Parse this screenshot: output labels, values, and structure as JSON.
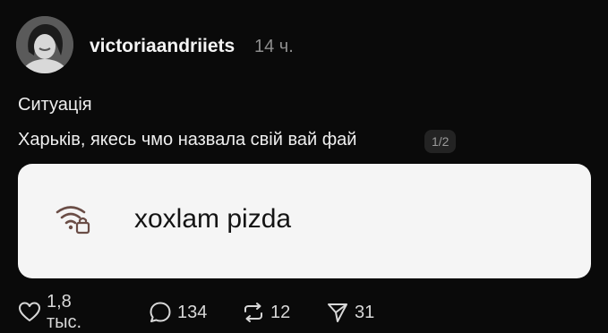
{
  "post": {
    "author": "victoriaandriiets",
    "time": "14 ч.",
    "line1": "Ситуація",
    "line2": "Харьків, якесь чмо назвала свій вай фай",
    "pager": "1/2"
  },
  "image": {
    "network_name": "xoxlam pizda",
    "icon": "wifi-lock-icon"
  },
  "actions": {
    "likes": "1,8 тыс.",
    "comments": "134",
    "reposts": "12",
    "shares": "31"
  }
}
